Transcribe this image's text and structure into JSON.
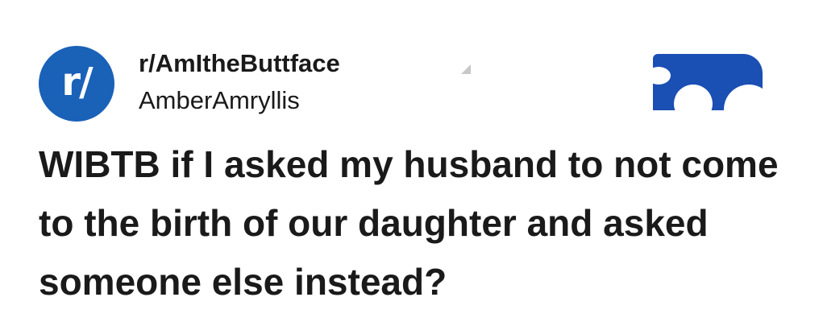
{
  "post": {
    "subreddit": "r/AmItheButtface",
    "username": "AmberAmryllis",
    "avatar_text": "r/",
    "title": "WIBTB if I asked my husband to not come to the birth of our daughter and asked someone else instead?"
  },
  "icons": {
    "avatar": "subreddit-avatar-icon",
    "join": "join-button"
  },
  "colors": {
    "avatar_bg": "#1a61b8",
    "join_bg": "#1a4fb4",
    "text": "#1a1a1b"
  }
}
